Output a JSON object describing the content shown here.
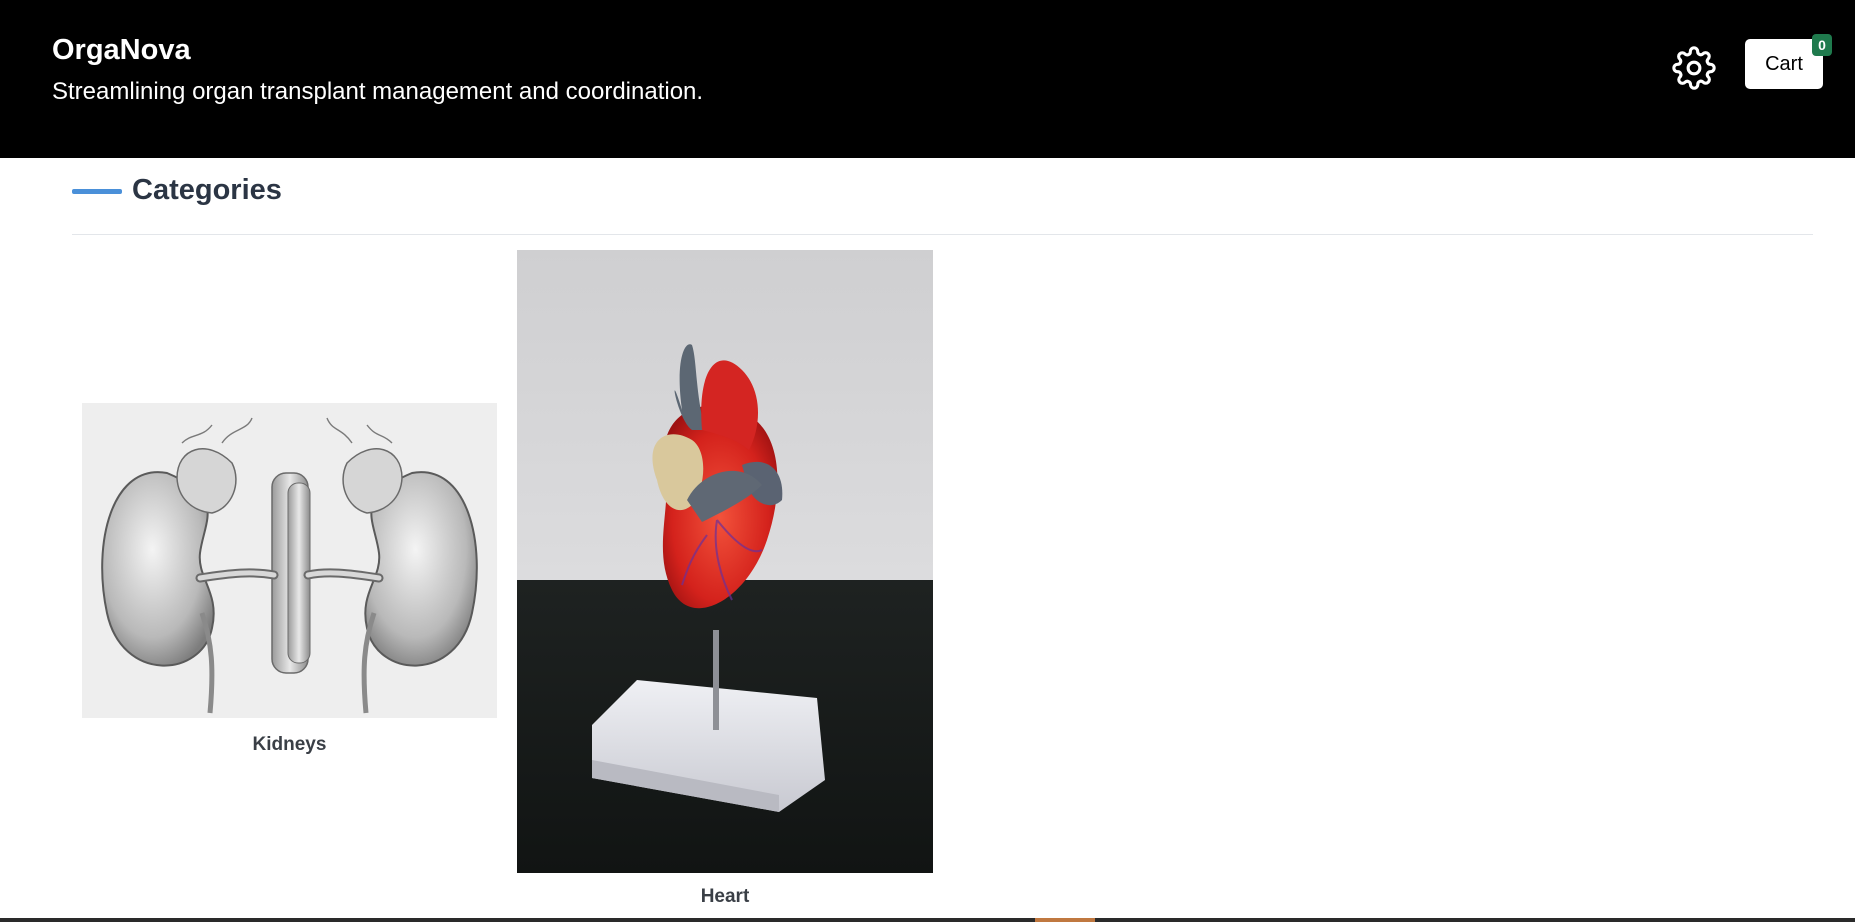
{
  "header": {
    "title": "OrgaNova",
    "tagline": "Streamlining organ transplant management and coordination.",
    "settings_icon": "gear-icon",
    "cart_label": "Cart",
    "cart_count": "0"
  },
  "categories": {
    "heading": "Categories",
    "items": [
      {
        "label": "Kidneys",
        "image": "kidneys-illustration"
      },
      {
        "label": "Heart",
        "image": "heart-model-photo"
      }
    ]
  },
  "colors": {
    "header_bg": "#000000",
    "accent_bar": "#4a90d9",
    "badge_bg": "#1f7a4d",
    "heading_text": "#2b3544"
  }
}
